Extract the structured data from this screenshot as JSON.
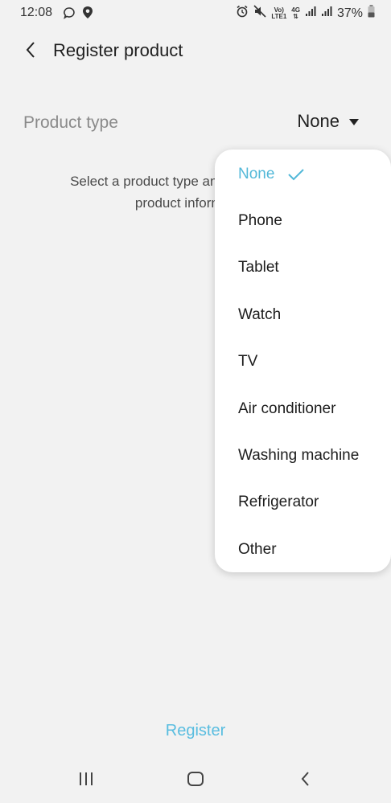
{
  "status_bar": {
    "time": "12:08",
    "battery": "37%",
    "network_top": "Vo)",
    "network_bottom": "LTE1",
    "network_type": "4G"
  },
  "header": {
    "title": "Register product"
  },
  "product_type": {
    "label": "Product type",
    "value": "None"
  },
  "hint": {
    "line1": "Select a product type and then enter your",
    "line2": "product information."
  },
  "dropdown": {
    "options": [
      {
        "label": "None",
        "selected": true
      },
      {
        "label": "Phone",
        "selected": false
      },
      {
        "label": "Tablet",
        "selected": false
      },
      {
        "label": "Watch",
        "selected": false
      },
      {
        "label": "TV",
        "selected": false
      },
      {
        "label": "Air conditioner",
        "selected": false
      },
      {
        "label": "Washing machine",
        "selected": false
      },
      {
        "label": "Refrigerator",
        "selected": false
      },
      {
        "label": "Other",
        "selected": false
      }
    ]
  },
  "footer": {
    "register_label": "Register"
  },
  "colors": {
    "accent": "#52b8d8",
    "background": "#f2f2f2"
  }
}
